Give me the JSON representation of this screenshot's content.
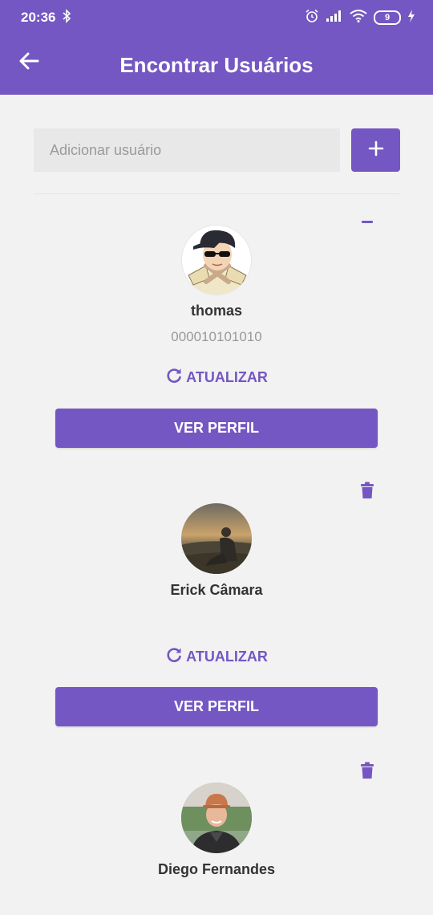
{
  "status_bar": {
    "time": "20:36",
    "battery": "9"
  },
  "app_bar": {
    "title": "Encontrar Usuários",
    "back_icon": "arrow-left-icon"
  },
  "search": {
    "placeholder": "Adicionar usuário",
    "value": "",
    "add_icon": "plus-icon"
  },
  "colors": {
    "primary": "#7457c2",
    "background": "#f2f2f2"
  },
  "users": [
    {
      "name": "thomas",
      "id": "000010101010",
      "action_icon": "minus-icon",
      "refresh_label": "ATUALIZAR",
      "profile_label": "VER PERFIL"
    },
    {
      "name": "Erick Câmara",
      "id": "",
      "action_icon": "trash-icon",
      "refresh_label": "ATUALIZAR",
      "profile_label": "VER PERFIL"
    },
    {
      "name": "Diego Fernandes",
      "id": "",
      "action_icon": "trash-icon"
    }
  ]
}
